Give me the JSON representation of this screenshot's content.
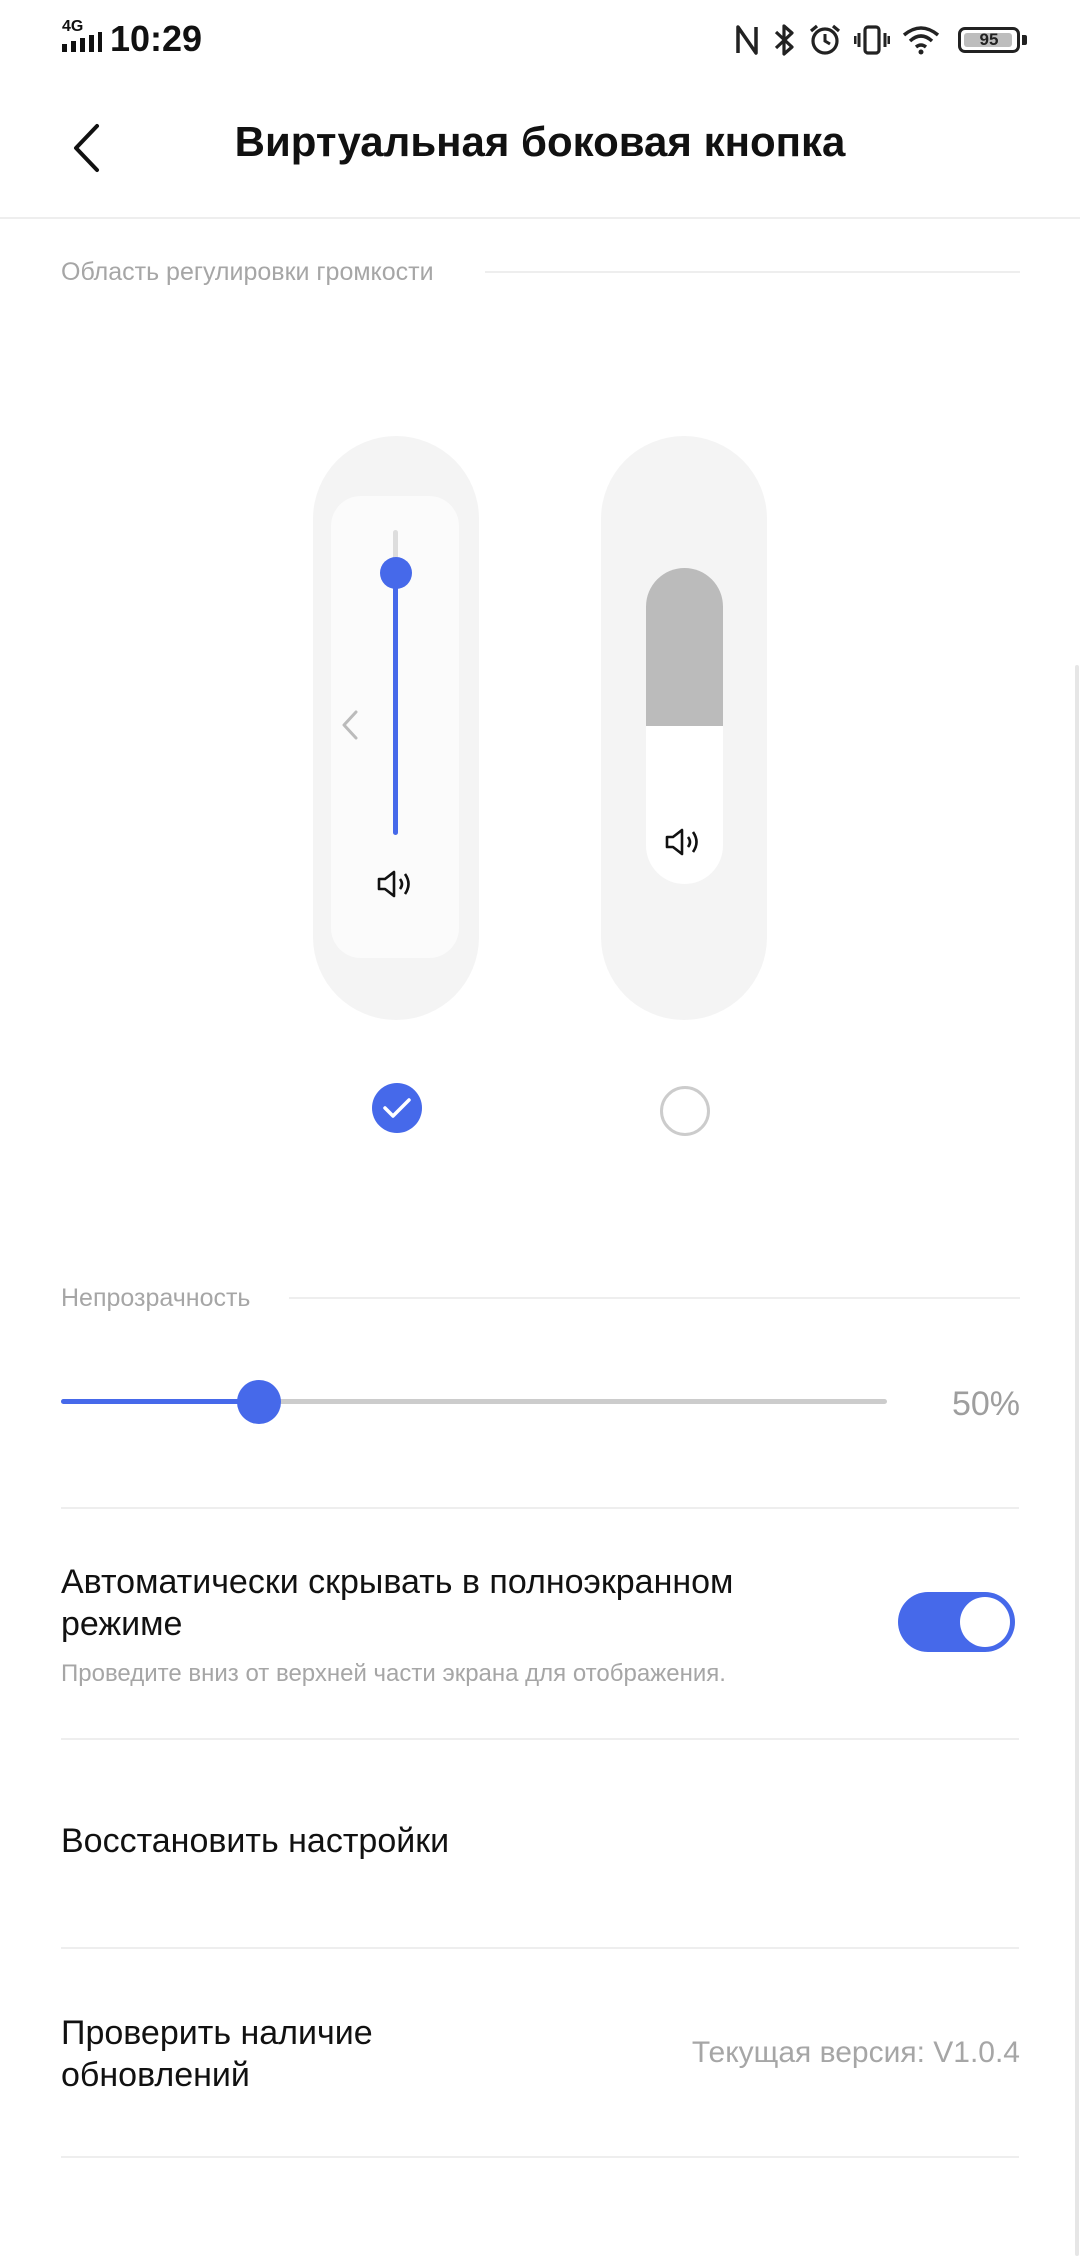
{
  "status_bar": {
    "network": "4G",
    "time": "10:29",
    "battery": "95",
    "battery_level": 0.95,
    "icons": [
      "nfc-icon",
      "bluetooth-icon",
      "alarm-icon",
      "vibrate-icon",
      "wifi-icon",
      "battery-icon"
    ]
  },
  "header": {
    "title": "Виртуальная боковая кнопка",
    "back_icon": "chevron-left-icon"
  },
  "volume_area": {
    "label": "Область регулировки громкости",
    "styles": [
      {
        "name": "slider-style",
        "selected": true,
        "level": 0.86
      },
      {
        "name": "block-style",
        "selected": false,
        "level": 0.5
      }
    ]
  },
  "opacity": {
    "label": "Непрозрачность",
    "value_text": "50%",
    "value": 0.24
  },
  "auto_hide": {
    "title": "Автоматически скрывать в полноэкранном режиме",
    "subtitle": "Проведите вниз от верхней части экрана для отображения.",
    "enabled": true
  },
  "restore": {
    "title": "Восстановить настройки"
  },
  "update": {
    "title": "Проверить наличие обновлений",
    "version": "Текущая версия: V1.0.4"
  },
  "colors": {
    "accent": "#4669ea",
    "divider": "#eeeeee",
    "secondary_text": "#a6a6a6"
  }
}
